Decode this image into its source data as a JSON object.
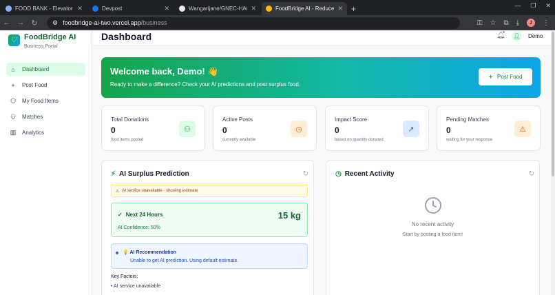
{
  "browser": {
    "tabs": [
      {
        "title": "FOOD BANK - Elevator pitch h",
        "color": "#8ab4f8",
        "active": false
      },
      {
        "title": "Devpost",
        "color": "#1a73e8",
        "active": false
      },
      {
        "title": "Wangarijane/GNEC-HACKATH",
        "color": "#e8eaed",
        "active": false
      },
      {
        "title": "FoodBridge AI - Reduce Food V",
        "color": "#fbbc04",
        "active": true
      }
    ],
    "url_host": "foodbridge-ai-two.vercel.app",
    "url_path": "/business",
    "profile_initial": "J"
  },
  "brand": {
    "name": "FoodBridge AI",
    "subtitle": "Business Portal"
  },
  "nav": [
    {
      "label": "Dashboard",
      "icon": "⌂",
      "active": true
    },
    {
      "label": "Post Food",
      "icon": "+",
      "active": false
    },
    {
      "label": "My Food Items",
      "icon": "⬡",
      "active": false
    },
    {
      "label": "Matches",
      "icon": "⚇",
      "active": false
    },
    {
      "label": "Analytics",
      "icon": "▥",
      "active": false
    }
  ],
  "header": {
    "title": "Dashboard",
    "user": "Demo"
  },
  "welcome": {
    "title": "Welcome back, Demo! 👋",
    "text": "Ready to make a difference? Check your AI predictions and post surplus food.",
    "button": "Post Food"
  },
  "stats": [
    {
      "label": "Total Donations",
      "value": "0",
      "sub": "food items posted",
      "icon": "⚇",
      "bg": "#dcfce7",
      "fg": "#16a34a"
    },
    {
      "label": "Active Posts",
      "value": "0",
      "sub": "currently available",
      "icon": "◷",
      "bg": "#ffedd5",
      "fg": "#ea580c"
    },
    {
      "label": "Impact Score",
      "value": "0",
      "sub": "based on quantity donated",
      "icon": "↗",
      "bg": "#dbeafe",
      "fg": "#2563eb"
    },
    {
      "label": "Pending Matches",
      "value": "0",
      "sub": "waiting for your response",
      "icon": "⚠",
      "bg": "#ffedd5",
      "fg": "#ea580c"
    }
  ],
  "prediction": {
    "title": "AI Surplus Prediction",
    "warning": "AI service unavailable - showing estimate",
    "period": "Next 24 Hours",
    "amount": "15 kg",
    "confidence": "AI Confidence: 50%",
    "rec_title": "💡 AI Recommendation",
    "rec_text": "Unable to get AI prediction. Using default estimate.",
    "key_factors_label": "Key Factors:",
    "key_factors": [
      "• AI service unavailable"
    ]
  },
  "activity": {
    "title": "Recent Activity",
    "empty_title": "No recent activity",
    "empty_sub": "Start by posting a food item!"
  }
}
